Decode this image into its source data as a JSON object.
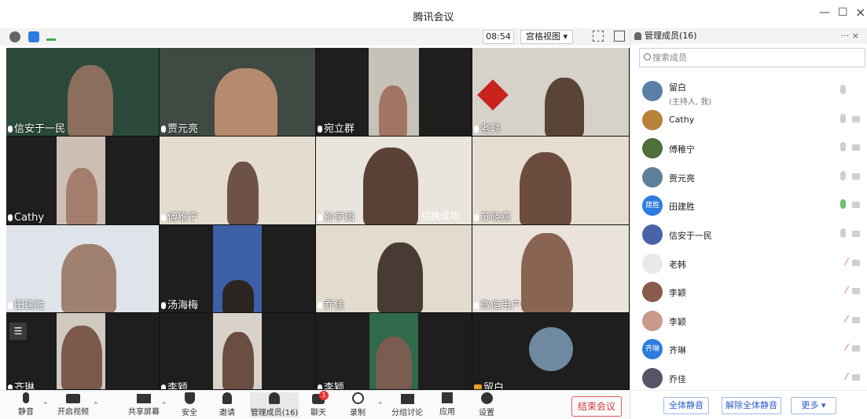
{
  "window": {
    "title": "腾讯会议",
    "minimize": "—",
    "maximize": "☐",
    "close": "×"
  },
  "topbar": {
    "time": "08:54",
    "view_label": "宫格视图 ▾"
  },
  "video_tiles": [
    {
      "name": "信安于一民"
    },
    {
      "name": "贾元亮"
    },
    {
      "name": "宛立群"
    },
    {
      "name": "老韩"
    },
    {
      "name": "Cathy"
    },
    {
      "name": "傅稚宁"
    },
    {
      "name": "孙学娟"
    },
    {
      "name": "苏晓燕"
    },
    {
      "name": "田建胜"
    },
    {
      "name": "汤海梅"
    },
    {
      "name": "乔佳"
    },
    {
      "name": "微信用户"
    },
    {
      "name": "齐琳"
    },
    {
      "name": "李颖"
    },
    {
      "name": "李颖"
    },
    {
      "name": "留白"
    }
  ],
  "toast": "切换成功",
  "toolbar": {
    "mute": "静音",
    "video": "开启视频",
    "share": "共享屏幕",
    "security": "安全",
    "invite": "邀请",
    "members": "管理成员(16)",
    "chat": "聊天",
    "chat_badge": "1",
    "record": "录制",
    "breakout": "分组讨论",
    "apps": "应用",
    "settings": "设置",
    "end": "结束会议"
  },
  "panel": {
    "title": "管理成员(16)",
    "more": "··· ×",
    "search_placeholder": "搜索成员",
    "members": [
      {
        "name": "留白",
        "sub": "(主持人, 我)",
        "avatar_color": "#5b7fa6"
      },
      {
        "name": "Cathy",
        "sub": "",
        "avatar_color": "#b9823a"
      },
      {
        "name": "傅稚宁",
        "sub": "",
        "avatar_color": "#4e6e3a"
      },
      {
        "name": "贾元亮",
        "sub": "",
        "avatar_color": "#5e7f9a"
      },
      {
        "name": "田建胜",
        "sub": "",
        "avatar_color": "#2f7be0",
        "avatar_text": "建胜"
      },
      {
        "name": "信安于一民",
        "sub": "",
        "avatar_color": "#4a62a8"
      },
      {
        "name": "老韩",
        "sub": "",
        "avatar_color": "#e9e9e9"
      },
      {
        "name": "李颖",
        "sub": "",
        "avatar_color": "#8a5a4a"
      },
      {
        "name": "李颖",
        "sub": "",
        "avatar_color": "#c99a8a"
      },
      {
        "name": "齐琳",
        "sub": "",
        "avatar_color": "#2f7be0",
        "avatar_text": "齐琳"
      },
      {
        "name": "乔佳",
        "sub": "",
        "avatar_color": "#556"
      }
    ],
    "mute_all": "全体静音",
    "unmute_all": "解除全体静音",
    "more_btn": "更多 ▾"
  }
}
